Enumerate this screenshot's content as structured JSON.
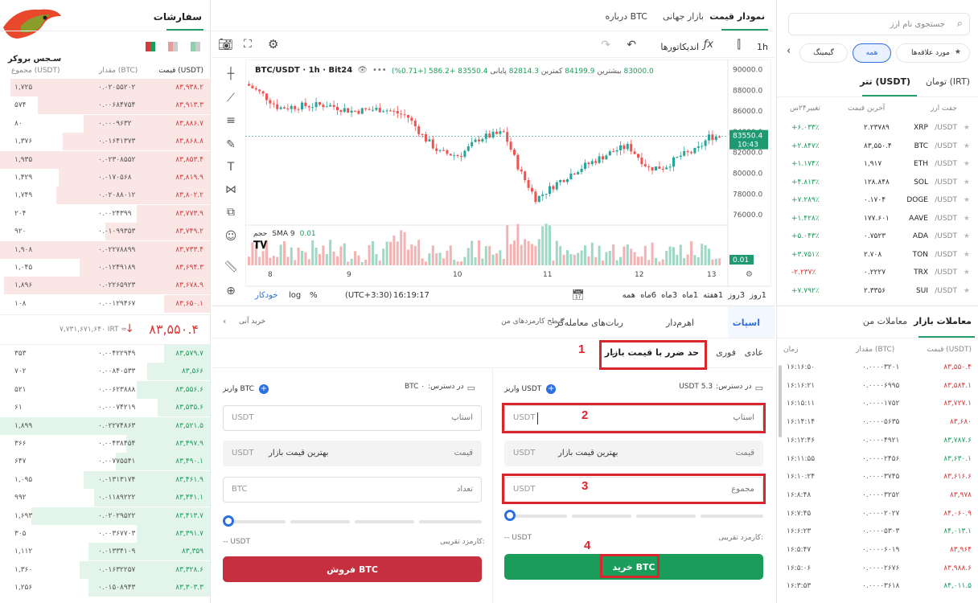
{
  "brand": {
    "name": "سـجس بروکر"
  },
  "orders": {
    "title": "سفارشات",
    "headers": {
      "price": "قیمت (USDT)",
      "amount": "مقدار (BTC)",
      "total": "مجموع (USDT)"
    },
    "asks": [
      {
        "price": "۸۳,۹۳۸.۲",
        "amount": "۰.۰۲۰۵۵۲۰۲",
        "total": "۱,۷۲۵",
        "depth": 0.95
      },
      {
        "price": "۸۳,۹۱۳.۳",
        "amount": "۰.۰۰۶۸۴۷۵۴",
        "total": "۵۷۴",
        "depth": 0.82
      },
      {
        "price": "۸۳,۸۸۶.۷",
        "amount": "۰.۰۰۰۹۶۳۲",
        "total": "۸۰",
        "depth": 0.6
      },
      {
        "price": "۸۳,۸۶۸.۸",
        "amount": "۰.۰۱۶۴۱۳۷۳",
        "total": "۱,۳۷۶",
        "depth": 0.7
      },
      {
        "price": "۸۳,۸۵۳.۴",
        "amount": "۰.۰۲۳۰۸۵۵۲",
        "total": "۱,۹۳۵",
        "depth": 1.0
      },
      {
        "price": "۸۳,۸۱۹.۹",
        "amount": "۰.۰۱۷۰۵۶۸",
        "total": "۱,۴۲۹",
        "depth": 0.72
      },
      {
        "price": "۸۳,۸۰۲.۲",
        "amount": "۰.۰۲۰۸۸۰۱۲",
        "total": "۱,۷۴۹",
        "depth": 0.73
      },
      {
        "price": "۸۳,۷۷۳.۹",
        "amount": "۰.۰۰۲۴۳۹۹",
        "total": "۲۰۴",
        "depth": 0.35
      },
      {
        "price": "۸۳,۷۴۹.۲",
        "amount": "۰.۰۱۰۹۹۳۵۳",
        "total": "۹۲۰",
        "depth": 0.5
      },
      {
        "price": "۸۳,۷۳۳.۴",
        "amount": "۰.۰۲۲۷۸۸۹۹",
        "total": "۱,۹۰۸",
        "depth": 1.0
      },
      {
        "price": "۸۳,۶۹۴.۳",
        "amount": "۰.۰۱۲۴۹۱۸۹",
        "total": "۱,۰۴۵",
        "depth": 0.62
      },
      {
        "price": "۸۳,۶۷۸.۹",
        "amount": "۰.۰۲۲۶۵۹۲۳",
        "total": "۱,۸۹۶",
        "depth": 0.98
      },
      {
        "price": "۸۳,۶۵۰.۱",
        "amount": "۰.۰۰۱۲۹۴۶۷",
        "total": "۱۰۸",
        "depth": 0.22
      }
    ],
    "last": {
      "price": "۸۳,۵۵۰.۴",
      "irt": "۷,۷۳۱,۶۷۱,۶۴۰ IRT ≈",
      "arrow": "↓"
    },
    "bids": [
      {
        "price": "۸۳,۵۷۹.۷",
        "amount": "۰.۰۰۴۲۲۹۴۹",
        "total": "۳۵۳",
        "depth": 0.22
      },
      {
        "price": "۸۳,۵۶۶",
        "amount": "۰.۰۰۸۴۰۵۳۳",
        "total": "۷۰۲",
        "depth": 0.3
      },
      {
        "price": "۸۳,۵۵۶.۶",
        "amount": "۰.۰۰۶۲۳۸۸۸",
        "total": "۵۲۱",
        "depth": 0.35
      },
      {
        "price": "۸۳,۵۳۵.۶",
        "amount": "۰.۰۰۰۷۴۲۱۹",
        "total": "۶۱",
        "depth": 0.25
      },
      {
        "price": "۸۳,۵۲۱.۵",
        "amount": "۰.۰۲۲۷۴۸۶۳",
        "total": "۱,۸۹۹",
        "depth": 1.0
      },
      {
        "price": "۸۳,۴۹۷.۹",
        "amount": "۰.۰۰۴۳۸۴۵۴",
        "total": "۳۶۶",
        "depth": 0.4
      },
      {
        "price": "۸۳,۴۹۰.۱",
        "amount": "۰.۰۰۷۷۵۵۴۱",
        "total": "۶۴۷",
        "depth": 0.45
      },
      {
        "price": "۸۳,۴۶۱.۹",
        "amount": "۰.۰۱۳۱۳۱۷۴",
        "total": "۱,۰۹۵",
        "depth": 0.6
      },
      {
        "price": "۸۳,۴۴۱.۱",
        "amount": "۰.۰۱۱۸۹۲۲۲",
        "total": "۹۹۲",
        "depth": 0.55
      },
      {
        "price": "۸۳,۴۱۳.۷",
        "amount": "۰.۰۲۰۲۹۵۲۲",
        "total": "۱,۶۹۳",
        "depth": 0.85
      },
      {
        "price": "۸۳,۳۹۱.۷",
        "amount": "۰.۰۰۳۶۷۷۰۳",
        "total": "۳۰۵",
        "depth": 0.35
      },
      {
        "price": "۸۳,۳۵۹",
        "amount": "۰.۰۱۳۳۴۱۰۹",
        "total": "۱,۱۱۲",
        "depth": 0.58
      },
      {
        "price": "۸۳,۳۲۸.۶",
        "amount": "۰.۰۱۶۳۲۲۵۷",
        "total": "۱,۳۶۰",
        "depth": 0.62
      },
      {
        "price": "۸۳,۳۰۳.۳",
        "amount": "۰.۰۱۵۰۸۹۴۳",
        "total": "۱,۲۵۶",
        "depth": 0.58
      }
    ]
  },
  "chart": {
    "tabs": [
      "نمودار قیمت",
      "بازار جهانی",
      "درباره BTC"
    ],
    "interval": "1h",
    "indicators": "اندیکاتورها",
    "symbol": "BTC/USDT · 1h · Bit24",
    "open": "83000.0",
    "high_label": "بیشترین",
    "high": "84199.9",
    "low_label": "کمترین",
    "low": "82814.3",
    "close_label": "پایانی",
    "close": "83550.4",
    "change": "+586.2 (+0.71%)",
    "price_tag": "83550.4",
    "time_tag": "10:43",
    "volume_label": "حجم",
    "sma": "SMA 9",
    "sma_val": "0.01",
    "vol_tag": "0.01",
    "y_ticks": [
      "90000.0",
      "88000.0",
      "86000.0",
      "84000.0",
      "82000.0",
      "80000.0",
      "78000.0",
      "76000.0"
    ],
    "x_ticks": [
      "8",
      "9",
      "10",
      "11",
      "12",
      "13"
    ],
    "ranges": [
      "1روز",
      "3روز",
      "1هفته",
      "1ماه",
      "3ماه",
      "6ماه",
      "همه"
    ],
    "clock": "16:19:17",
    "tz": "(UTC+3:30)",
    "pct": "%",
    "log": "log",
    "auto": "خودکار"
  },
  "trade": {
    "tabs": {
      "spot": "اسپات",
      "leverage": "اهرم‌دار",
      "bots": "ربات‌های معامله‌گر",
      "fee": "سطح کارمزدهای من",
      "fee_link": "خرید آنی"
    },
    "types": {
      "normal": "عادی",
      "instant": "فوری",
      "stop": "حد ضرر با قیمت بازار"
    },
    "buy": {
      "avail_label": "در دسترس:",
      "avail": "5.3 USDT",
      "deposit": "واریز USDT",
      "stop_label": "استاپ",
      "stop_unit": "USDT",
      "price_label": "قیمت",
      "price_val": "بهترین قیمت بازار",
      "price_unit": "USDT",
      "total_label": "مجموع",
      "total_unit": "USDT",
      "fee_label": "کارمزد تقریبی:",
      "fee_val": "-- USDT",
      "btn": "خرید BTC"
    },
    "sell": {
      "avail_label": "در دسترس:",
      "avail": "BTC ۰",
      "deposit": "واریز BTC",
      "stop_label": "استاپ",
      "stop_unit": "USDT",
      "price_label": "قیمت",
      "price_val": "بهترین قیمت بازار",
      "price_unit": "USDT",
      "amount_label": "تعداد",
      "amount_unit": "BTC",
      "fee_label": "کارمزد تقریبی:",
      "fee_val": "-- USDT",
      "btn": "فروش BTC"
    },
    "callouts": [
      "1",
      "2",
      "3",
      "4"
    ]
  },
  "markets": {
    "search_placeholder": "جستجوی نام ارز",
    "filters": {
      "fav": "مورد علاقه‌ها",
      "all": "همه",
      "gaming": "گیمینگ"
    },
    "tabs": {
      "usdt": "تتر (USDT)",
      "irt": "تومان (IRT)"
    },
    "headers": {
      "pair": "جفت ارز",
      "last": "آخرین قیمت",
      "change": "تغییر۲۴س"
    },
    "rows": [
      {
        "pair": "XRP",
        "quote": "/USDT",
        "last": "۲.۲۳۷۸۹",
        "change": "+۶.۰۳۳٪",
        "up": true
      },
      {
        "pair": "BTC",
        "quote": "/USDT",
        "last": "۸۳,۵۵۰.۴",
        "change": "+۲.۸۴۷٪",
        "up": true
      },
      {
        "pair": "ETH",
        "quote": "/USDT",
        "last": "۱,۹۱۷",
        "change": "+۱.۱۷۴٪",
        "up": true
      },
      {
        "pair": "SOL",
        "quote": "/USDT",
        "last": "۱۲۸.۸۴۸",
        "change": "+۴.۸۱۳٪",
        "up": true
      },
      {
        "pair": "DOGE",
        "quote": "/USDT",
        "last": "۰.۱۷۰۴",
        "change": "+۷.۲۸۹٪",
        "up": true
      },
      {
        "pair": "AAVE",
        "quote": "/USDT",
        "last": "۱۷۷.۶۰۱",
        "change": "+۱.۴۲۸٪",
        "up": true
      },
      {
        "pair": "ADA",
        "quote": "/USDT",
        "last": "۰.۷۵۲۳",
        "change": "+۵.۰۴۳٪",
        "up": true
      },
      {
        "pair": "TON",
        "quote": "/USDT",
        "last": "۲.۷۰۸",
        "change": "+۳.۷۵۱٪",
        "up": true
      },
      {
        "pair": "TRX",
        "quote": "/USDT",
        "last": "۰.۲۲۲۷",
        "change": "-۲.۲۳۷٪",
        "up": false
      },
      {
        "pair": "SUI",
        "quote": "/USDT",
        "last": "۲.۳۳۵۶",
        "change": "+۷.۷۹۲٪",
        "up": true
      }
    ]
  },
  "trades": {
    "tabs": {
      "market": "معاملات بازار",
      "mine": "معاملات من"
    },
    "headers": {
      "price": "قیمت (USDT)",
      "amount": "مقدار (BTC)",
      "time": "زمان"
    },
    "rows": [
      {
        "price": "۸۳,۵۵۰.۴",
        "amount": "۰.۰۰۰۰۳۲۰۱",
        "time": "۱۶:۱۶:۵۰",
        "up": false
      },
      {
        "price": "۸۳,۵۸۴.۱",
        "amount": "۰.۰۰۰۰۶۹۹۵",
        "time": "۱۶:۱۶:۲۱",
        "up": false
      },
      {
        "price": "۸۳,۷۲۷.۱",
        "amount": "۰.۰۰۰۰۱۷۵۲",
        "time": "۱۶:۱۵:۱۱",
        "up": false
      },
      {
        "price": "۸۳,۶۸۰",
        "amount": "۰.۰۰۰۰۵۶۳۵",
        "time": "۱۶:۱۴:۱۴",
        "up": false
      },
      {
        "price": "۸۳,۷۸۷.۶",
        "amount": "۰.۰۰۰۰۴۹۲۱",
        "time": "۱۶:۱۲:۴۶",
        "up": true
      },
      {
        "price": "۸۳,۶۳۰.۱",
        "amount": "۰.۰۰۰۰۲۴۵۶",
        "time": "۱۶:۱۱:۵۵",
        "up": true
      },
      {
        "price": "۸۳,۶۱۶.۶",
        "amount": "۰.۰۰۰۰۳۷۴۵",
        "time": "۱۶:۱۰:۲۴",
        "up": false
      },
      {
        "price": "۸۳,۹۷۸",
        "amount": "۰.۰۰۰۰۳۲۵۲",
        "time": "۱۶:۸:۴۸",
        "up": false
      },
      {
        "price": "۸۴,۰۶۰.۹",
        "amount": "۰.۰۰۰۰۲۰۲۷",
        "time": "۱۶:۷:۴۵",
        "up": false
      },
      {
        "price": "۸۴,۰۱۳.۱",
        "amount": "۰.۰۰۰۰۵۳۰۳",
        "time": "۱۶:۶:۲۳",
        "up": true
      },
      {
        "price": "۸۳,۹۶۴",
        "amount": "۰.۰۰۰۰۶۰۱۹",
        "time": "۱۶:۵:۴۷",
        "up": false
      },
      {
        "price": "۸۳,۹۸۸.۶",
        "amount": "۰.۰۰۰۰۲۶۷۶",
        "time": "۱۶:۵:۰۶",
        "up": false
      },
      {
        "price": "۸۴,۰۱۱.۵",
        "amount": "۰.۰۰۰۰۳۶۱۸",
        "time": "۱۶:۳:۵۳",
        "up": true
      }
    ]
  }
}
